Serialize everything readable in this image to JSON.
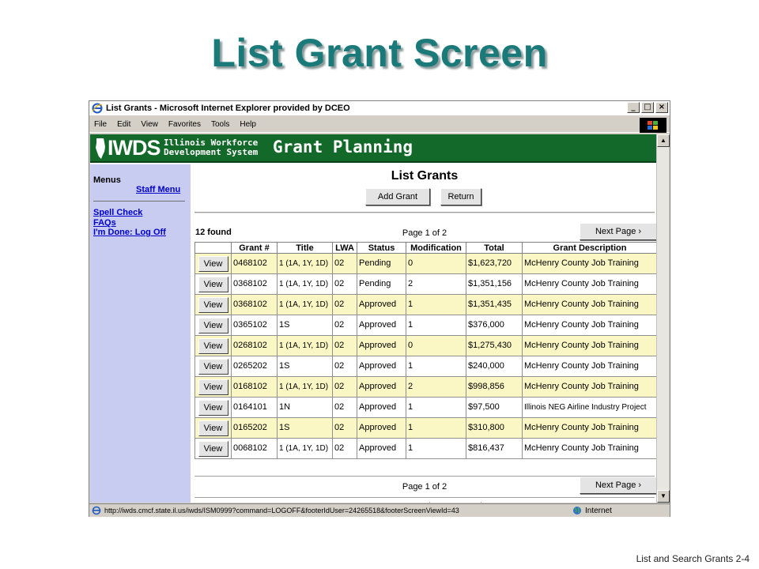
{
  "slide": {
    "title": "List Grant Screen",
    "footer": "List and Search Grants 2-4"
  },
  "browser": {
    "title": "List Grants - Microsoft Internet Explorer provided by DCEO",
    "menus": [
      "File",
      "Edit",
      "View",
      "Favorites",
      "Tools",
      "Help"
    ],
    "controls": {
      "minimize": "_",
      "restore": "□",
      "close": "×"
    },
    "status_url": "http://iwds.cmcf.state.il.us/iwds/ISM0999?command=LOGOFF&footerIdUser=24265518&footerScreenViewId=43",
    "status_zone": "Internet"
  },
  "header": {
    "logo_main": "IWDS",
    "logo_line1": "Illinois Workforce",
    "logo_line2": "Development System",
    "title": "Grant Planning"
  },
  "nav": {
    "heading": "Menus",
    "staff_menu": "Staff Menu",
    "spell_check": "Spell Check",
    "faqs": "FAQs",
    "log_off": "I'm Done: Log Off"
  },
  "content": {
    "title": "List Grants",
    "add_grant": "Add Grant",
    "return": "Return",
    "found": "12  found",
    "page_info": "Page 1 of 2",
    "next_page": "Next Page ›"
  },
  "table": {
    "columns": [
      "",
      "Grant #",
      "Title",
      "LWA",
      "Status",
      "Modification",
      "Total",
      "Grant Description"
    ],
    "view_label": "View",
    "rows": [
      {
        "grant": "0468102",
        "title": "1 (1A, 1Y, 1D)",
        "lwa": "02",
        "status": "Pending",
        "mod": "0",
        "total": "$1,623,720",
        "desc": "McHenry County Job Training"
      },
      {
        "grant": "0368102",
        "title": "1 (1A, 1Y, 1D)",
        "lwa": "02",
        "status": "Pending",
        "mod": "2",
        "total": "$1,351,156",
        "desc": "McHenry County Job Training"
      },
      {
        "grant": "0368102",
        "title": "1 (1A, 1Y, 1D)",
        "lwa": "02",
        "status": "Approved",
        "mod": "1",
        "total": "$1,351,435",
        "desc": "McHenry County Job Training"
      },
      {
        "grant": "0365102",
        "title": "1S",
        "lwa": "02",
        "status": "Approved",
        "mod": "1",
        "total": "$376,000",
        "desc": "McHenry County Job Training"
      },
      {
        "grant": "0268102",
        "title": "1 (1A, 1Y, 1D)",
        "lwa": "02",
        "status": "Approved",
        "mod": "0",
        "total": "$1,275,430",
        "desc": "McHenry County Job Training"
      },
      {
        "grant": "0265202",
        "title": "1S",
        "lwa": "02",
        "status": "Approved",
        "mod": "1",
        "total": "$240,000",
        "desc": "McHenry County Job Training"
      },
      {
        "grant": "0168102",
        "title": "1 (1A, 1Y, 1D)",
        "lwa": "02",
        "status": "Approved",
        "mod": "2",
        "total": "$998,856",
        "desc": "McHenry County Job Training"
      },
      {
        "grant": "0164101",
        "title": "1N",
        "lwa": "02",
        "status": "Approved",
        "mod": "1",
        "total": "$97,500",
        "desc": "Illinois NEG Airline Industry Project"
      },
      {
        "grant": "0165202",
        "title": "1S",
        "lwa": "02",
        "status": "Approved",
        "mod": "1",
        "total": "$310,800",
        "desc": "McHenry County Job Training"
      },
      {
        "grant": "0068102",
        "title": "1 (1A, 1Y, 1D)",
        "lwa": "02",
        "status": "Approved",
        "mod": "1",
        "total": "$816,437",
        "desc": "McHenry County Job Training"
      }
    ]
  },
  "colors": {
    "title_teal": "#1a7a7a",
    "header_green": "#13692a",
    "nav_lavender": "#c8ccf0",
    "row_highlight": "#fbf7c4"
  }
}
